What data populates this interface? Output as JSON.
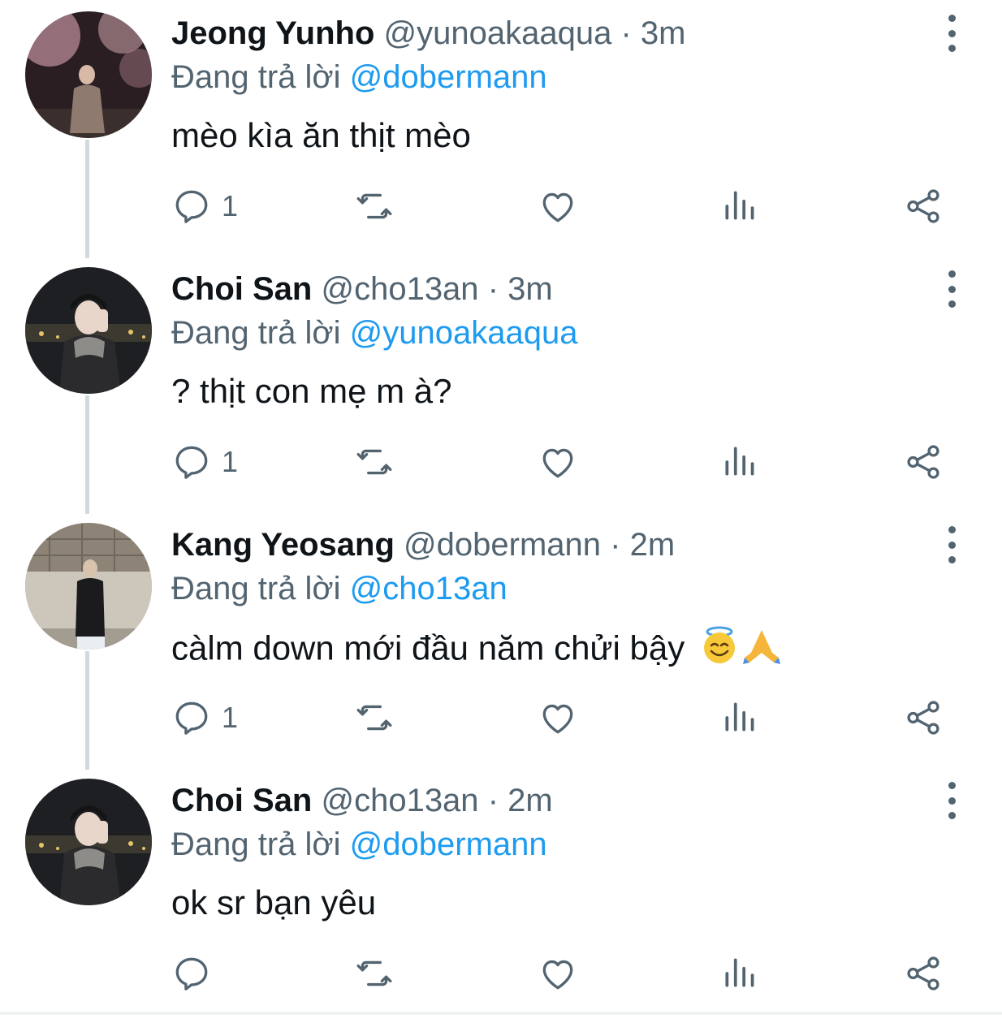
{
  "reply_prefix": "Đang trả lời",
  "colors": {
    "accent": "#1d9bf0",
    "secondary_text": "#536471",
    "primary_text": "#0f1419",
    "thread_line": "#cfd9de"
  },
  "tweets": [
    {
      "name": "Jeong Yunho",
      "handle": "@yunoakaaqua",
      "separator": "·",
      "time": "3m",
      "reply_prefix": "Đang trả lời",
      "reply_to": "@dobermann",
      "text": "mèo kìa ăn thịt mèo",
      "reply_count": "1",
      "avatar": "avatar-night-blossom"
    },
    {
      "name": "Choi San",
      "handle": "@cho13an",
      "separator": "·",
      "time": "3m",
      "reply_prefix": "Đang trả lời",
      "reply_to": "@yunoakaaqua",
      "text": "? thịt con mẹ m à?",
      "reply_count": "1",
      "avatar": "avatar-hoodie-night"
    },
    {
      "name": "Kang Yeosang",
      "handle": "@dobermann",
      "separator": "·",
      "time": "2m",
      "reply_prefix": "Đang trả lời",
      "reply_to": "@cho13an",
      "text": "càlm down mới đầu năm chửi bậy",
      "emojis": [
        "smiling-face-with-halo-emoji",
        "folded-hands-emoji"
      ],
      "reply_count": "1",
      "avatar": "avatar-building-standing"
    },
    {
      "name": "Choi San",
      "handle": "@cho13an",
      "separator": "·",
      "time": "2m",
      "reply_prefix": "Đang trả lời",
      "reply_to": "@dobermann",
      "text": "ok sr bạn yêu",
      "reply_count": "",
      "avatar": "avatar-hoodie-night"
    }
  ]
}
